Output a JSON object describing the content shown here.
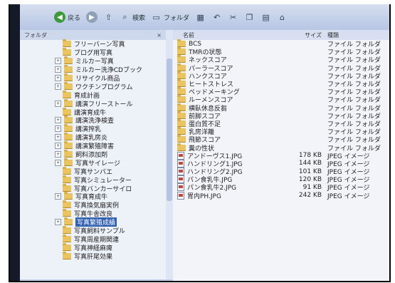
{
  "toolbar": {
    "back_label": "戻る",
    "search_label": "検索",
    "folders_label": "フォルダ"
  },
  "folder_pane": {
    "header_label": "フォルダ",
    "close_label": "×",
    "items": [
      {
        "label": "フリーバーン写真",
        "expander": ""
      },
      {
        "label": "ブログ用写真",
        "expander": ""
      },
      {
        "label": "ミルカー写真",
        "expander": "+"
      },
      {
        "label": "ミルカー洗浄CDブック",
        "expander": "+"
      },
      {
        "label": "リサイクル商品",
        "expander": "+"
      },
      {
        "label": "ワクチンプログラム",
        "expander": "+"
      },
      {
        "label": "育成計画",
        "expander": ""
      },
      {
        "label": "講演フリーストール",
        "expander": "+"
      },
      {
        "label": "講演育成牛",
        "expander": ""
      },
      {
        "label": "講演洗浄検査",
        "expander": "+"
      },
      {
        "label": "講演搾乳",
        "expander": "+"
      },
      {
        "label": "講演乳房炎",
        "expander": "+"
      },
      {
        "label": "講演繁殖障害",
        "expander": "+"
      },
      {
        "label": "飼料添加剤",
        "expander": "+"
      },
      {
        "label": "写真サイレージ",
        "expander": "+"
      },
      {
        "label": "写真サンバエ",
        "expander": ""
      },
      {
        "label": "写真シミュレーター",
        "expander": ""
      },
      {
        "label": "写真バンカーサイロ",
        "expander": ""
      },
      {
        "label": "写真育成牛",
        "expander": "+"
      },
      {
        "label": "写真換気扇実例",
        "expander": ""
      },
      {
        "label": "写真牛舎改良",
        "expander": ""
      },
      {
        "label": "写真繁殖成績",
        "expander": "+",
        "selected": true
      },
      {
        "label": "写真飼料サンプル",
        "expander": ""
      },
      {
        "label": "写真周産期関連",
        "expander": ""
      },
      {
        "label": "写真神経麻痺",
        "expander": ""
      },
      {
        "label": "写真肝尾効果",
        "expander": ""
      }
    ]
  },
  "file_list": {
    "columns": {
      "name": "名前",
      "size": "サイズ",
      "type": "種類"
    },
    "rows": [
      {
        "name": "BCS",
        "size": "",
        "type": "ファイル フォルダ",
        "kind": "folder"
      },
      {
        "name": "TMRの状態",
        "size": "",
        "type": "ファイル フォルダ",
        "kind": "folder"
      },
      {
        "name": "ネックスコア",
        "size": "",
        "type": "ファイル フォルダ",
        "kind": "folder"
      },
      {
        "name": "パーラースコア",
        "size": "",
        "type": "ファイル フォルダ",
        "kind": "folder"
      },
      {
        "name": "ハンクスコア",
        "size": "",
        "type": "ファイル フォルダ",
        "kind": "folder"
      },
      {
        "name": "ヒートストレス",
        "size": "",
        "type": "ファイル フォルダ",
        "kind": "folder"
      },
      {
        "name": "ベッドメーキング",
        "size": "",
        "type": "ファイル フォルダ",
        "kind": "folder"
      },
      {
        "name": "ルーメンスコア",
        "size": "",
        "type": "ファイル フォルダ",
        "kind": "folder"
      },
      {
        "name": "横臥休息反芻",
        "size": "",
        "type": "ファイル フォルダ",
        "kind": "folder"
      },
      {
        "name": "前脚スコア",
        "size": "",
        "type": "ファイル フォルダ",
        "kind": "folder"
      },
      {
        "name": "蛋白質不足",
        "size": "",
        "type": "ファイル フォルダ",
        "kind": "folder"
      },
      {
        "name": "乳房洋離",
        "size": "",
        "type": "ファイル フォルダ",
        "kind": "folder"
      },
      {
        "name": "飛節スコア",
        "size": "",
        "type": "ファイル フォルダ",
        "kind": "folder"
      },
      {
        "name": "糞の性状",
        "size": "",
        "type": "ファイル フォルダ",
        "kind": "folder"
      },
      {
        "name": "アンドーヴス1.JPG",
        "size": "178 KB",
        "type": "JPEG イメージ",
        "kind": "file"
      },
      {
        "name": "ハンドリング1.JPG",
        "size": "144 KB",
        "type": "JPEG イメージ",
        "kind": "file"
      },
      {
        "name": "ハンドリング2.JPG",
        "size": "101 KB",
        "type": "JPEG イメージ",
        "kind": "file"
      },
      {
        "name": "パン食乳牛.JPG",
        "size": "120 KB",
        "type": "JPEG イメージ",
        "kind": "file"
      },
      {
        "name": "パン食乳牛2.JPG",
        "size": "91 KB",
        "type": "JPEG イメージ",
        "kind": "file"
      },
      {
        "name": "胃内PH.JPG",
        "size": "242 KB",
        "type": "JPEG イメージ",
        "kind": "file"
      }
    ]
  }
}
